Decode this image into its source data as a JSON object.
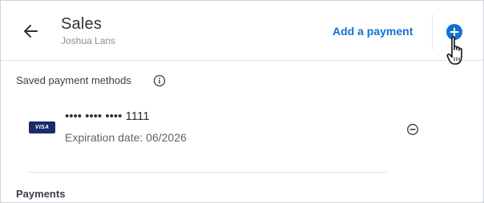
{
  "header": {
    "title": "Sales",
    "subtitle": "Joshua Lans",
    "add_payment_label": "Add a payment"
  },
  "saved_methods": {
    "section_title": "Saved payment methods",
    "cards": [
      {
        "brand": "VISA",
        "number": "•••• •••• •••• 1111",
        "expiration": "Expiration date: 06/2026"
      }
    ]
  },
  "payments": {
    "section_title": "Payments"
  },
  "icons": {
    "back": "arrow-left-icon",
    "add": "plus-circle-icon",
    "cursor": "hand-pointer-icon",
    "info": "info-circle-icon",
    "remove": "minus-circle-icon"
  },
  "colors": {
    "accent": "#1271d3",
    "visa_blue": "#1b2a6b",
    "text": "#2b2f36",
    "muted": "#8a8f96",
    "divider": "#e2e5e9"
  }
}
